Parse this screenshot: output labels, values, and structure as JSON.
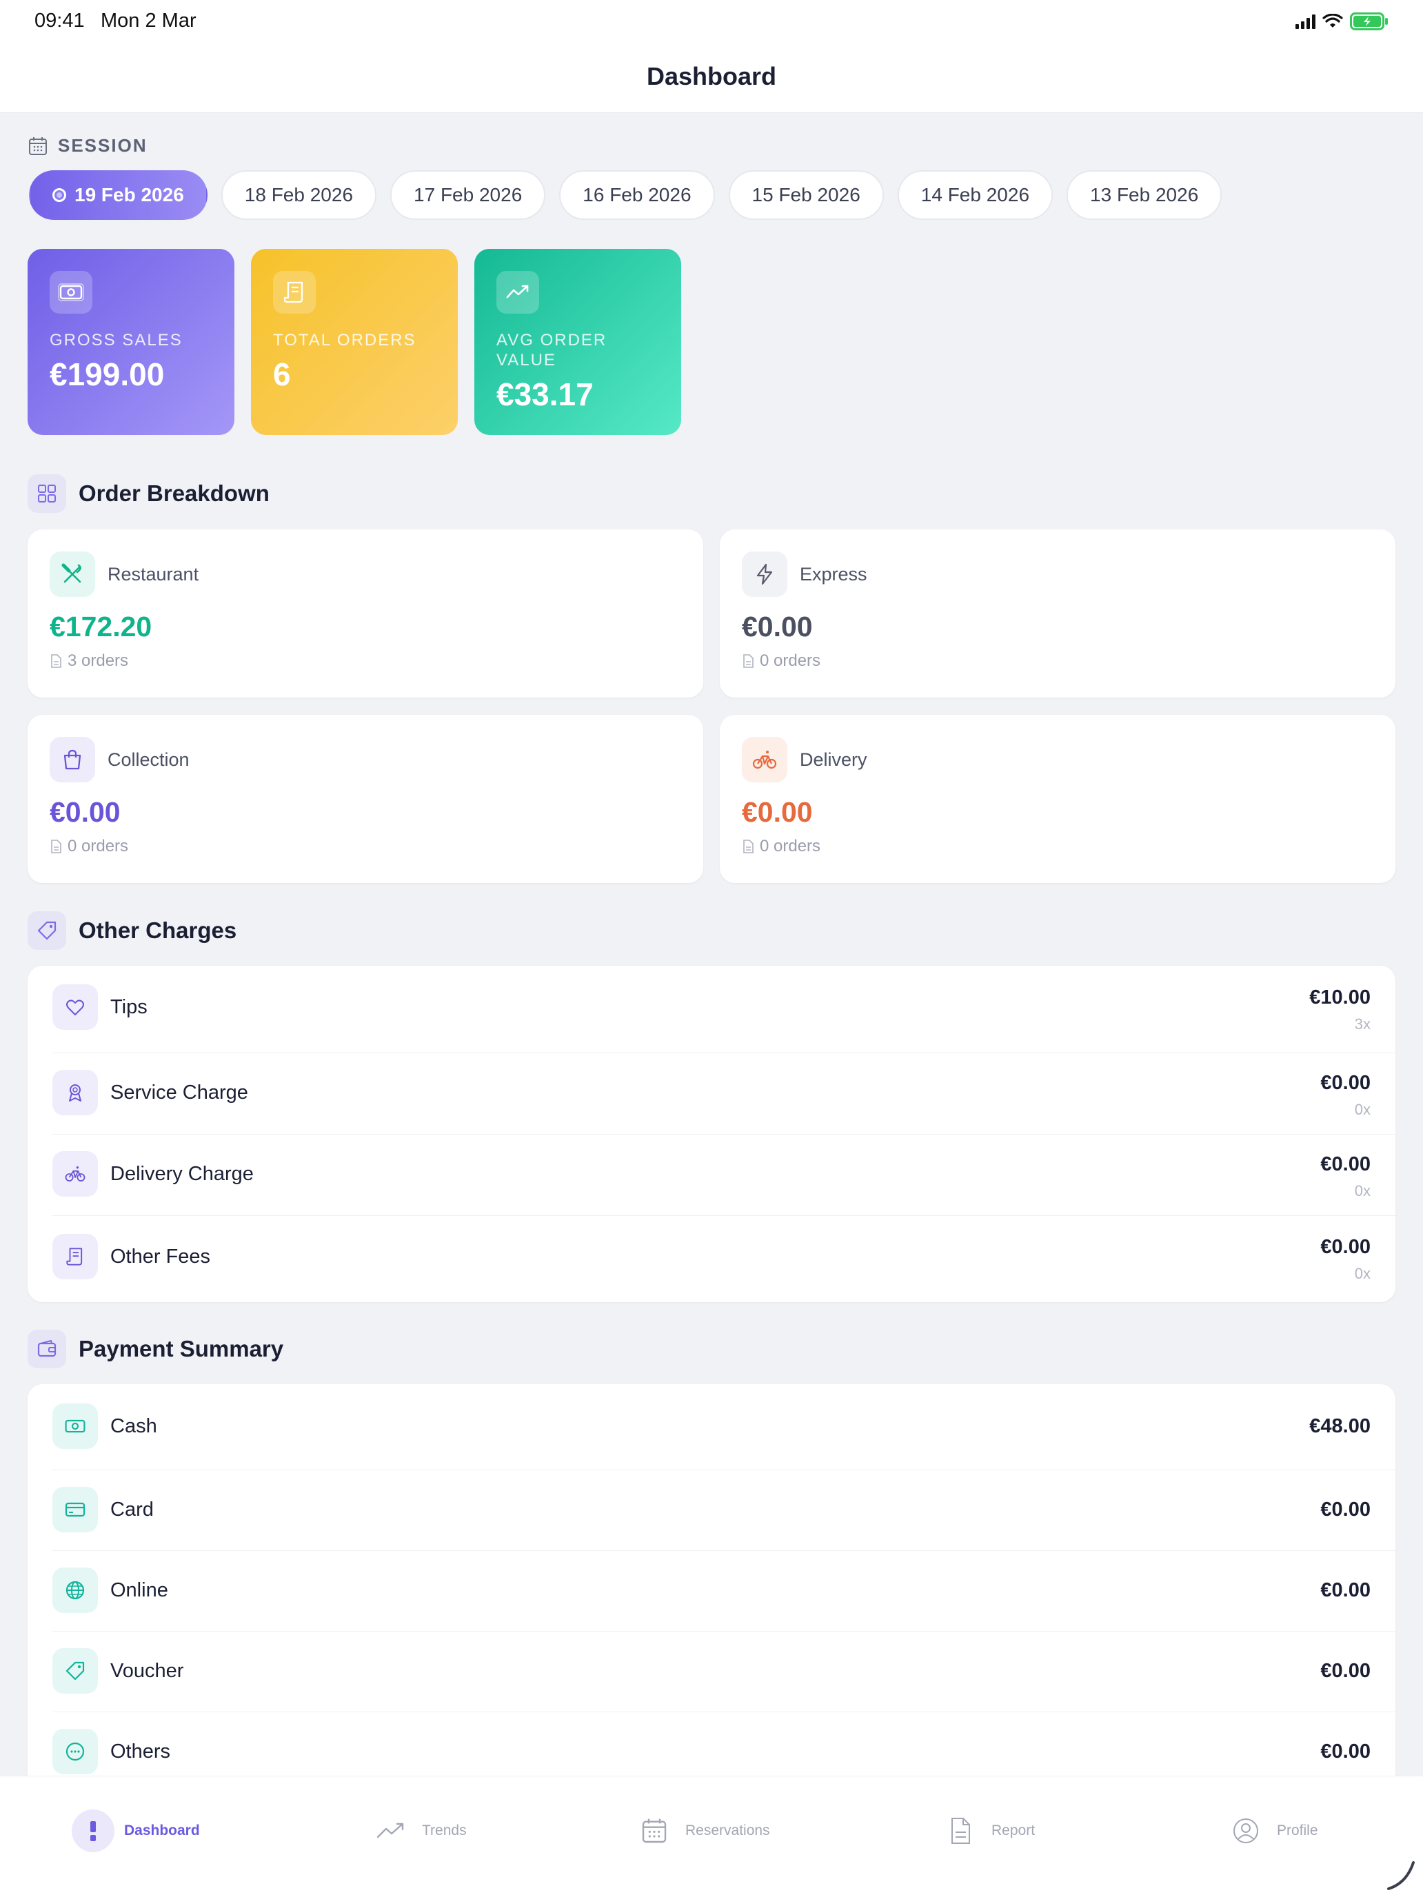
{
  "status_bar": {
    "time": "09:41",
    "date": "Mon 2 Mar"
  },
  "header": {
    "title": "Dashboard"
  },
  "session": {
    "label": "SESSION",
    "dates": [
      "19 Feb 2026",
      "18 Feb 2026",
      "17 Feb 2026",
      "16 Feb 2026",
      "15 Feb 2026",
      "14 Feb 2026",
      "13 Feb 2026"
    ],
    "selected_index": 0
  },
  "stats": {
    "gross_sales": {
      "label": "GROSS SALES",
      "value": "€199.00",
      "icon": "cash-icon"
    },
    "total_orders": {
      "label": "TOTAL ORDERS",
      "value": "6",
      "icon": "receipt-icon"
    },
    "avg_order_value": {
      "label": "AVG ORDER VALUE",
      "value": "€33.17",
      "icon": "trend-icon"
    }
  },
  "order_breakdown": {
    "title": "Order Breakdown",
    "items": [
      {
        "name": "Restaurant",
        "value": "€172.20",
        "orders": "3 orders",
        "color": "#0fb48c",
        "icon": "utensils-icon"
      },
      {
        "name": "Express",
        "value": "€0.00",
        "orders": "0 orders",
        "color": "#4a5060",
        "icon": "lightning-icon"
      },
      {
        "name": "Collection",
        "value": "€0.00",
        "orders": "0 orders",
        "color": "#6a55d8",
        "icon": "shopping-bag-icon"
      },
      {
        "name": "Delivery",
        "value": "€0.00",
        "orders": "0 orders",
        "color": "#e66a3e",
        "icon": "bicycle-icon"
      }
    ]
  },
  "other_charges": {
    "title": "Other Charges",
    "items": [
      {
        "name": "Tips",
        "amount": "€10.00",
        "count": "3x",
        "icon": "heart-icon"
      },
      {
        "name": "Service Charge",
        "amount": "€0.00",
        "count": "0x",
        "icon": "award-icon"
      },
      {
        "name": "Delivery Charge",
        "amount": "€0.00",
        "count": "0x",
        "icon": "bicycle-icon"
      },
      {
        "name": "Other Fees",
        "amount": "€0.00",
        "count": "0x",
        "icon": "receipt-icon"
      }
    ]
  },
  "payment_summary": {
    "title": "Payment Summary",
    "items": [
      {
        "name": "Cash",
        "amount": "€48.00",
        "icon": "cash-icon"
      },
      {
        "name": "Card",
        "amount": "€0.00",
        "icon": "card-icon"
      },
      {
        "name": "Online",
        "amount": "€0.00",
        "icon": "globe-icon"
      },
      {
        "name": "Voucher",
        "amount": "€0.00",
        "icon": "tag-icon"
      },
      {
        "name": "Others",
        "amount": "€0.00",
        "icon": "dots-icon"
      }
    ]
  },
  "tabbar": {
    "tabs": [
      {
        "label": "Dashboard",
        "icon": "dashboard-icon",
        "active": true
      },
      {
        "label": "Trends",
        "icon": "trend-icon",
        "active": false
      },
      {
        "label": "Reservations",
        "icon": "calendar-icon",
        "active": false
      },
      {
        "label": "Report",
        "icon": "document-icon",
        "active": false
      },
      {
        "label": "Profile",
        "icon": "user-circle-icon",
        "active": false
      }
    ]
  },
  "colors": {
    "accent": "#6a5ae0",
    "teal": "#14b994",
    "yellow": "#f6c22a",
    "orange": "#e66a3e"
  }
}
